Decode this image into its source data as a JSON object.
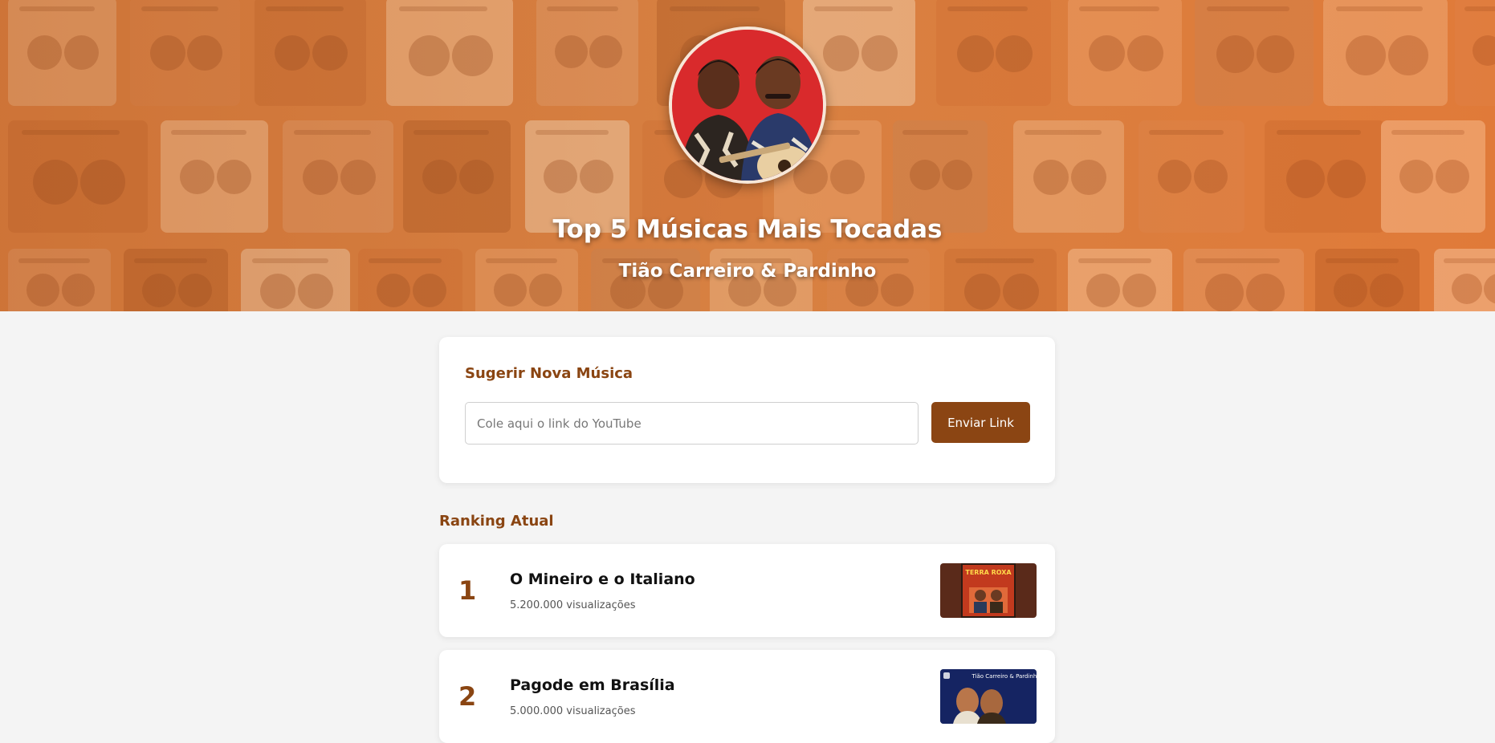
{
  "hero": {
    "title": "Top 5 Músicas Mais Tocadas",
    "subtitle": "Tião Carreiro & Pardinho",
    "avatar_alt": "Tião Carreiro & Pardinho"
  },
  "suggest": {
    "heading": "Sugerir Nova Música",
    "input_placeholder": "Cole aqui o link do YouTube",
    "input_value": "",
    "button_label": "Enviar Link"
  },
  "ranking": {
    "heading": "Ranking Atual",
    "items": [
      {
        "rank": "1",
        "title": "O Mineiro e o Italiano",
        "views": "5.200.000 visualizações",
        "thumb_text": "TERRA ROXA"
      },
      {
        "rank": "2",
        "title": "Pagode em Brasília",
        "views": "5.000.000 visualizações",
        "thumb_text": "Tião Carreiro & Pardinho"
      }
    ]
  },
  "colors": {
    "accent": "#8b4513",
    "hero_base": "#d9874a",
    "background": "#f4f4f4",
    "card": "#ffffff"
  }
}
